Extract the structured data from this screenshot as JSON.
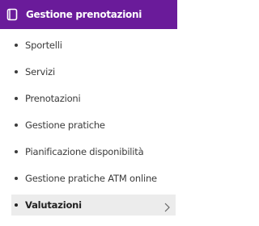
{
  "header": {
    "title": "Gestione prenotazioni",
    "icon": "booking-icon"
  },
  "menu": {
    "items": [
      {
        "label": "Sportelli"
      },
      {
        "label": "Servizi"
      },
      {
        "label": "Prenotazioni"
      },
      {
        "label": "Gestione pratiche"
      },
      {
        "label": "Pianificazione disponibilità"
      },
      {
        "label": "Gestione pratiche ATM online"
      },
      {
        "label": "Valutazioni",
        "active": true
      }
    ]
  },
  "colors": {
    "header_bg": "#6a1b9a",
    "active_bg": "#ececec",
    "text": "#3b3b3b"
  }
}
